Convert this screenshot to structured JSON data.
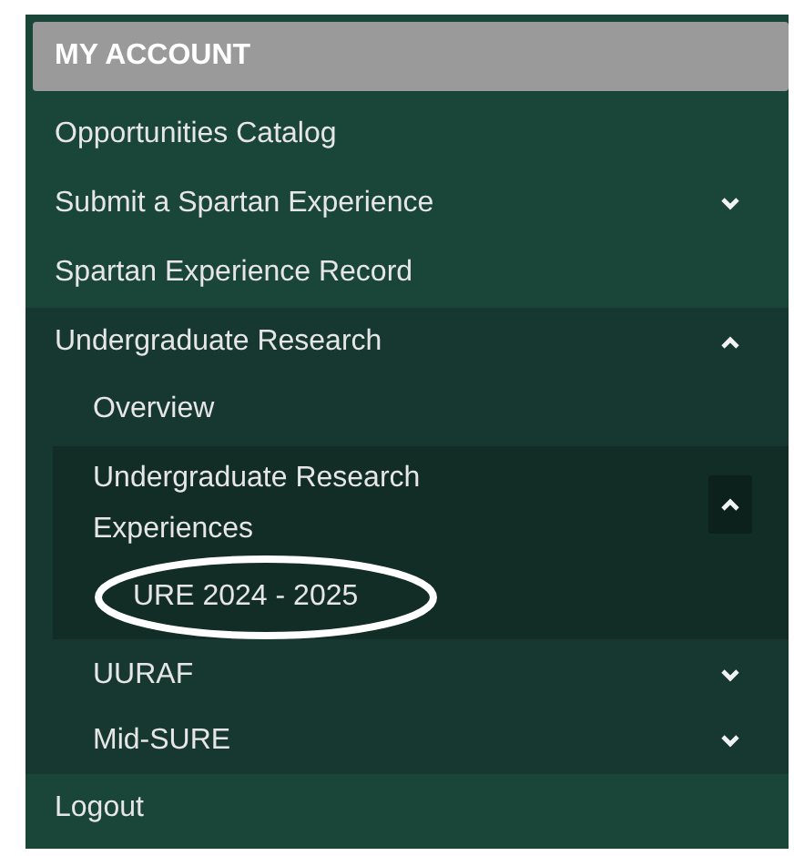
{
  "menu": {
    "title": "MY ACCOUNT",
    "items": [
      {
        "label": "Opportunities Catalog"
      },
      {
        "label": "Submit a Spartan Experience",
        "expanded": false
      },
      {
        "label": "Spartan Experience Record"
      },
      {
        "label": "Undergraduate Research",
        "expanded": true,
        "children": [
          {
            "label": "Overview"
          },
          {
            "label": "Undergraduate Research Experiences",
            "expanded": true,
            "children": [
              {
                "label": "URE 2024 - 2025",
                "circled": true
              }
            ]
          },
          {
            "label": "UURAF",
            "expanded": false
          },
          {
            "label": "Mid-SURE",
            "expanded": false
          }
        ]
      },
      {
        "label": "Logout"
      }
    ]
  }
}
